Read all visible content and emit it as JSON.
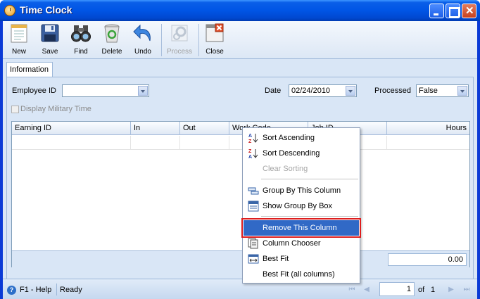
{
  "window": {
    "title": "Time Clock"
  },
  "toolbar": {
    "buttons": [
      {
        "label": "New",
        "icon": "new-document-icon",
        "enabled": true
      },
      {
        "label": "Save",
        "icon": "floppy-disk-icon",
        "enabled": true
      },
      {
        "label": "Find",
        "icon": "binoculars-icon",
        "enabled": true
      },
      {
        "label": "Delete",
        "icon": "recycle-bin-icon",
        "enabled": true
      },
      {
        "label": "Undo",
        "icon": "undo-arrow-icon",
        "enabled": true
      },
      {
        "label": "Process",
        "icon": "process-gear-icon",
        "enabled": false
      },
      {
        "label": "Close",
        "icon": "close-window-icon",
        "enabled": true
      }
    ]
  },
  "tabs": [
    {
      "label": "Information",
      "active": true
    }
  ],
  "form": {
    "employee_id_label": "Employee ID",
    "employee_id_value": "",
    "date_label": "Date",
    "date_value": "02/24/2010",
    "processed_label": "Processed",
    "processed_value": "False",
    "military_time_label": "Display Military Time",
    "military_time_checked": false
  },
  "grid": {
    "columns": [
      "Earning ID",
      "In",
      "Out",
      "Work Code",
      "Job ID",
      "Hours"
    ],
    "rows": [
      [
        "",
        "",
        "",
        "",
        "",
        ""
      ]
    ],
    "total_hours": "0.00"
  },
  "context_menu": {
    "items": [
      {
        "label": "Sort Ascending",
        "icon": "sort-ascending-icon",
        "enabled": true,
        "highlighted": false
      },
      {
        "label": "Sort Descending",
        "icon": "sort-descending-icon",
        "enabled": true,
        "highlighted": false
      },
      {
        "label": "Clear Sorting",
        "icon": "",
        "enabled": false,
        "highlighted": false
      },
      {
        "label": "Group By This Column",
        "icon": "group-by-column-icon",
        "enabled": true,
        "highlighted": false
      },
      {
        "label": "Show Group By Box",
        "icon": "group-by-box-icon",
        "enabled": true,
        "highlighted": false
      },
      {
        "label": "Remove This Column",
        "icon": "",
        "enabled": true,
        "highlighted": true
      },
      {
        "label": "Column Chooser",
        "icon": "column-chooser-icon",
        "enabled": true,
        "highlighted": false
      },
      {
        "label": "Best Fit",
        "icon": "best-fit-icon",
        "enabled": true,
        "highlighted": false
      },
      {
        "label": "Best Fit (all columns)",
        "icon": "",
        "enabled": true,
        "highlighted": false
      }
    ]
  },
  "statusbar": {
    "help_label": "F1 - Help",
    "status": "Ready",
    "page_current": "1",
    "page_of_label": "of",
    "page_total": "1"
  }
}
